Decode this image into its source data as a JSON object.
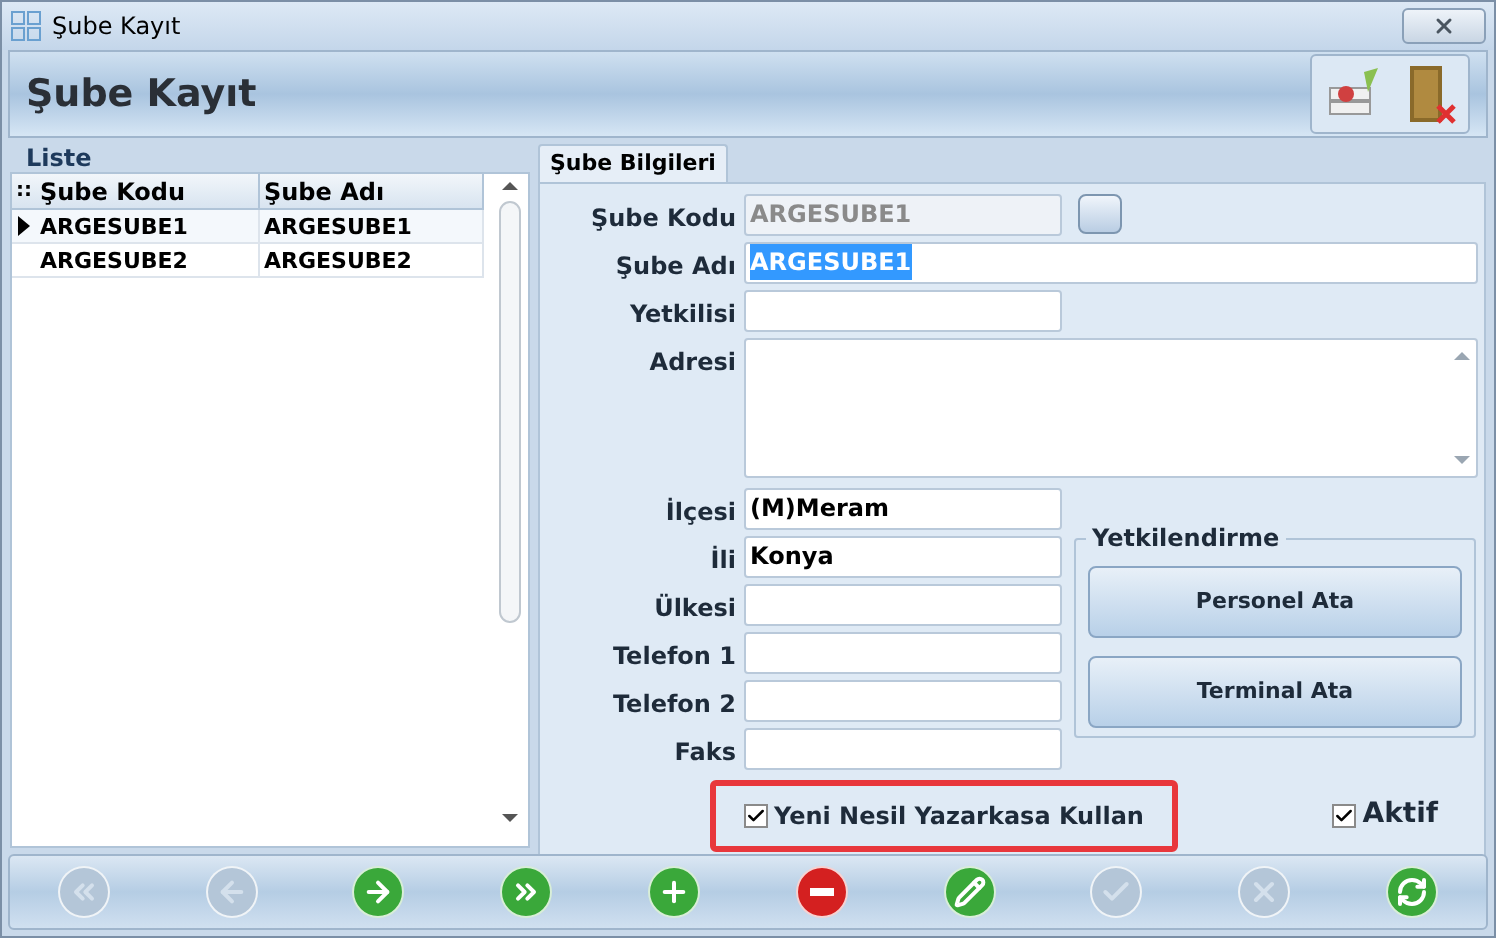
{
  "window": {
    "title": "Şube Kayıt"
  },
  "header": {
    "title": "Şube Kayıt"
  },
  "list": {
    "title": "Liste",
    "corner": "::",
    "columns": [
      "Şube Kodu",
      "Şube Adı"
    ],
    "rows": [
      {
        "cells": [
          "ARGESUBE1",
          "ARGESUBE1"
        ],
        "selected": true
      },
      {
        "cells": [
          "ARGESUBE2",
          "ARGESUBE2"
        ],
        "selected": false
      }
    ]
  },
  "tabs": [
    {
      "label": "Şube Bilgileri",
      "selected": true
    }
  ],
  "fields": [
    {
      "label": "Şube Kodu",
      "value": "ARGESUBE1",
      "kind": "short",
      "disabled": true,
      "selected": false
    },
    {
      "label": "Şube Adı",
      "value": "ARGESUBE1",
      "kind": "wide",
      "disabled": false,
      "selected": true
    },
    {
      "label": "Yetkilisi",
      "kind": "short",
      "disabled": false
    },
    {
      "label": "Adresi",
      "kind": "memo",
      "disabled": false
    },
    {
      "label": "İlçesi",
      "value": "(M)Meram",
      "kind": "short",
      "disabled": false,
      "selected": false
    },
    {
      "label": "İli",
      "value": "Konya",
      "kind": "short",
      "disabled": false,
      "selected": false
    },
    {
      "label": "Ülkesi",
      "kind": "short",
      "disabled": false
    },
    {
      "label": "Telefon 1",
      "kind": "short",
      "disabled": false
    },
    {
      "label": "Telefon 2",
      "kind": "short",
      "disabled": false
    },
    {
      "label": "Faks",
      "kind": "short",
      "disabled": false
    }
  ],
  "authorization": {
    "title": "Yetkilendirme",
    "buttons": [
      "Personel Ata",
      "Terminal Ata"
    ]
  },
  "checkboxes": [
    {
      "label": "Yeni Nesil Yazarkasa Kullan",
      "checked": true,
      "highlighted": true
    },
    {
      "label": "Aktif",
      "checked": true,
      "highlighted": false
    }
  ],
  "toolbar": [
    {
      "kind": "first",
      "disabled": true
    },
    {
      "kind": "prev",
      "disabled": true
    },
    {
      "kind": "next",
      "disabled": false
    },
    {
      "kind": "last",
      "disabled": false
    },
    {
      "kind": "add",
      "disabled": false
    },
    {
      "kind": "delete",
      "disabled": false
    },
    {
      "kind": "edit",
      "disabled": false
    },
    {
      "kind": "save",
      "disabled": true
    },
    {
      "kind": "cancel",
      "disabled": true
    },
    {
      "kind": "refresh",
      "disabled": false
    }
  ]
}
